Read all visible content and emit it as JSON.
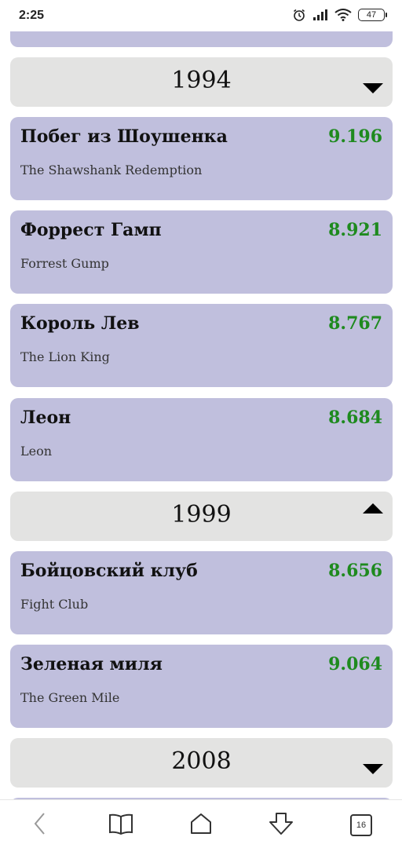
{
  "status_bar": {
    "time": "2:25",
    "battery": "47",
    "icons": [
      "alarm-icon",
      "signal-icon",
      "wifi-icon",
      "battery-icon"
    ]
  },
  "colors": {
    "card_bg": "#c0bfdd",
    "header_bg": "#e3e3e2",
    "rating": "#1e8a1e"
  },
  "groups": [
    {
      "year": "1994",
      "expanded": false,
      "films": [
        {
          "title": "Побег из Шоушенка",
          "original": "The Shawshank Redemption",
          "rating": "9.196"
        },
        {
          "title": "Форрест Гамп",
          "original": "Forrest Gump",
          "rating": "8.921"
        },
        {
          "title": "Король Лев",
          "original": "The Lion King",
          "rating": "8.767"
        },
        {
          "title": "Леон",
          "original": "Leon",
          "rating": "8.684"
        }
      ]
    },
    {
      "year": "1999",
      "expanded": true,
      "films": [
        {
          "title": "Бойцовский клуб",
          "original": "Fight Club",
          "rating": "8.656"
        },
        {
          "title": "Зеленая миля",
          "original": "The Green Mile",
          "rating": "9.064"
        }
      ]
    },
    {
      "year": "2008",
      "expanded": false,
      "films": []
    }
  ],
  "bottom_nav": {
    "tabs_count": "16",
    "icons": [
      "back-icon",
      "bookmarks-icon",
      "home-icon",
      "downloads-icon",
      "tabs-icon"
    ]
  }
}
